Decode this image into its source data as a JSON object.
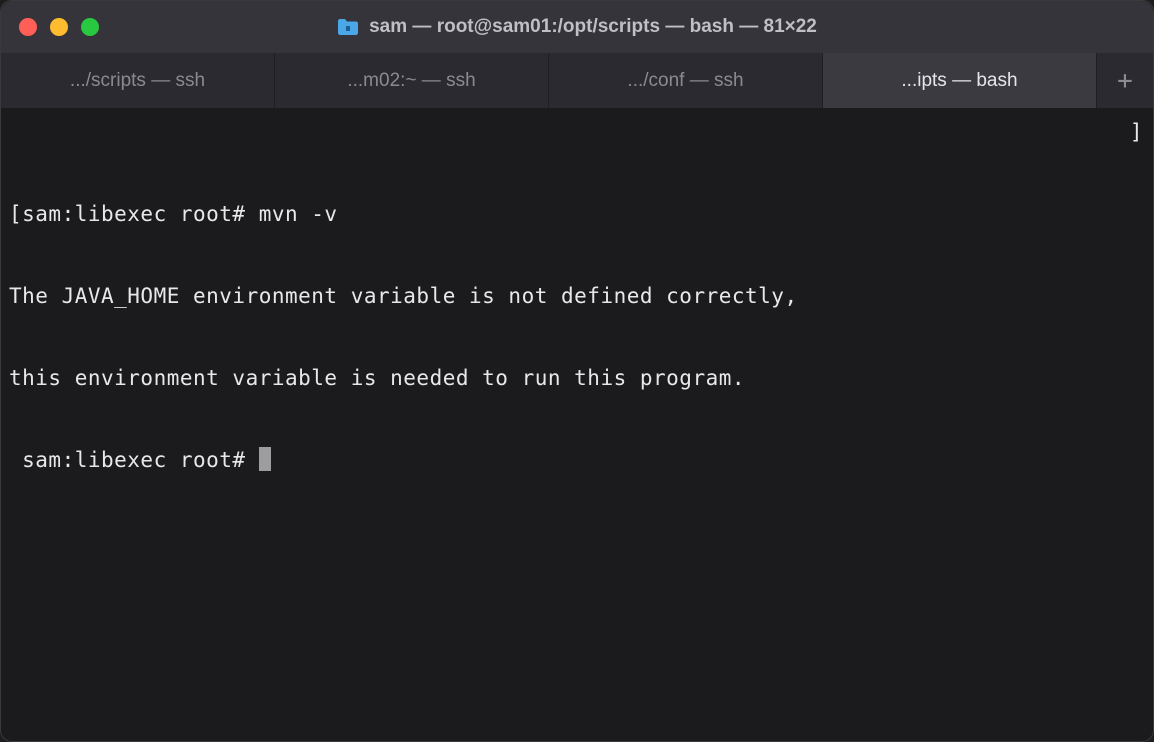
{
  "titlebar": {
    "title": "sam — root@sam01:/opt/scripts — bash — 81×22"
  },
  "tabs": [
    {
      "label": ".../scripts — ssh",
      "active": false
    },
    {
      "label": "...m02:~ — ssh",
      "active": false
    },
    {
      "label": ".../conf — ssh",
      "active": false
    },
    {
      "label": "...ipts — bash",
      "active": true
    }
  ],
  "terminal": {
    "line1_prefix": "[sam:libexec root# ",
    "line1_cmd": "mvn -v",
    "line2": "The JAVA_HOME environment variable is not defined correctly,",
    "line3": "this environment variable is needed to run this program.",
    "line4_prompt": " sam:libexec root# ",
    "right_bracket": "]"
  },
  "new_tab_glyph": "+"
}
